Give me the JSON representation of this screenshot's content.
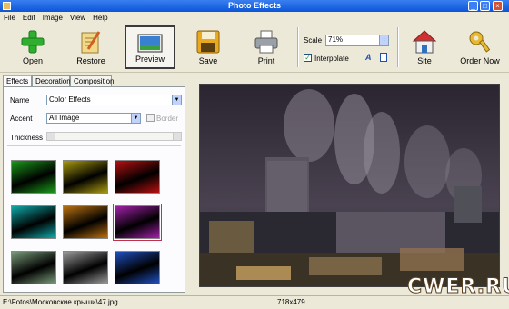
{
  "window": {
    "title": "Photo Effects"
  },
  "menu": [
    "File",
    "Edit",
    "Image",
    "View",
    "Help"
  ],
  "toolbar": {
    "open": "Open",
    "restore": "Restore",
    "preview": "Preview",
    "save": "Save",
    "print": "Print",
    "scale_label": "Scale",
    "scale_value": "71%",
    "interpolate_label": "Interpolate",
    "interpolate_checked": true,
    "site": "Site",
    "order": "Order Now"
  },
  "tabs": [
    "Effects",
    "Decoration",
    "Composition"
  ],
  "effects": {
    "name_label": "Name",
    "name_value": "Color Effects",
    "accent_label": "Accent",
    "accent_value": "All Image",
    "border_label": "Border",
    "thickness_label": "Thickness"
  },
  "thumbnails": [
    {
      "tint": "#1a9a1a"
    },
    {
      "tint": "#a89a10"
    },
    {
      "tint": "#b81010"
    },
    {
      "tint": "#10a8a8"
    },
    {
      "tint": "#b87010"
    },
    {
      "tint": "#a020a8",
      "selected": true
    },
    {
      "tint": "#7a9a7a"
    },
    {
      "tint": "#9a9a9a"
    },
    {
      "tint": "#2050c0"
    }
  ],
  "status": {
    "path": "E:\\Fotos\\Московские крыши\\47.jpg",
    "dimensions": "718x479"
  },
  "watermark": "CWER.RU"
}
